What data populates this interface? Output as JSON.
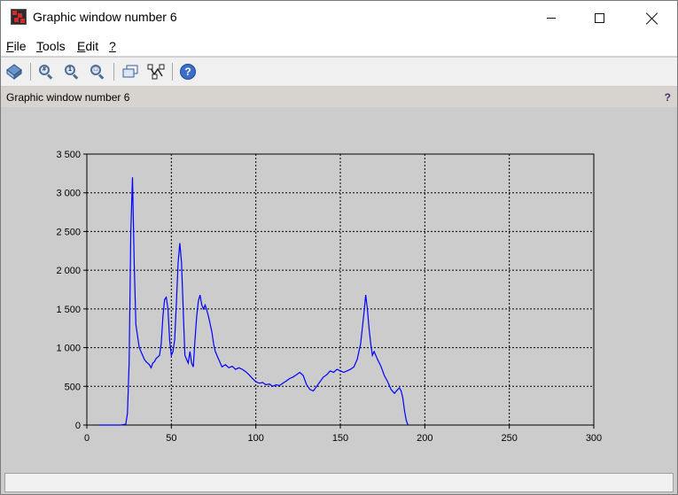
{
  "window": {
    "title": "Graphic window number 6",
    "minimize_icon": "minimize-icon",
    "maximize_icon": "maximize-icon",
    "close_icon": "close-icon"
  },
  "menu": {
    "items": [
      {
        "key": "F",
        "rest": "ile"
      },
      {
        "key": "T",
        "rest": "ools"
      },
      {
        "key": "E",
        "rest": "dit"
      },
      {
        "key": "?",
        "rest": ""
      }
    ]
  },
  "toolbar": {
    "buttons": [
      "rotate-icon",
      "zoom-grid-icon",
      "zoom-original-icon",
      "zoom-out-icon",
      "datatip-icon",
      "datatip-editor-icon",
      "help-icon"
    ]
  },
  "infobar": {
    "text": "Graphic window number 6",
    "help": "?"
  },
  "status": {
    "text": ""
  },
  "chart_data": {
    "type": "line",
    "title": "",
    "xlabel": "",
    "ylabel": "",
    "xlim": [
      0,
      300
    ],
    "ylim": [
      0,
      3500
    ],
    "x_ticks": [
      0,
      50,
      100,
      150,
      200,
      250,
      300
    ],
    "x_tick_labels": [
      "0",
      "50",
      "100",
      "150",
      "200",
      "250",
      "300"
    ],
    "y_ticks": [
      0,
      500,
      1000,
      1500,
      2000,
      2500,
      3000,
      3500
    ],
    "y_tick_labels": [
      "0",
      "500",
      "1 000",
      "1 500",
      "2 000",
      "2 500",
      "3 000",
      "3 500"
    ],
    "grid": true,
    "series": [
      {
        "color": "#0000ff",
        "x": [
          7,
          10,
          15,
          20,
          23,
          24,
          25,
          26,
          27,
          28,
          29,
          30,
          31,
          32,
          33,
          34,
          35,
          36,
          37,
          38,
          39,
          40,
          41,
          42,
          43,
          44,
          45,
          46,
          47,
          48,
          49,
          50,
          51,
          52,
          53,
          54,
          55,
          56,
          57,
          58,
          59,
          60,
          61,
          62,
          63,
          64,
          65,
          66,
          67,
          68,
          69,
          70,
          71,
          72,
          73,
          74,
          75,
          76,
          78,
          80,
          82,
          84,
          86,
          88,
          90,
          92,
          94,
          96,
          98,
          100,
          102,
          104,
          106,
          108,
          110,
          112,
          114,
          116,
          118,
          120,
          122,
          124,
          126,
          128,
          130,
          132,
          134,
          136,
          138,
          140,
          142,
          144,
          146,
          148,
          150,
          152,
          154,
          156,
          158,
          160,
          161,
          162,
          163,
          164,
          165,
          166,
          167,
          168,
          169,
          170,
          172,
          174,
          176,
          178,
          180,
          182,
          184,
          185,
          186,
          187,
          188,
          189,
          190
        ],
        "y": [
          0,
          0,
          0,
          0,
          10,
          150,
          800,
          2500,
          3200,
          2100,
          1300,
          1150,
          1000,
          950,
          900,
          850,
          820,
          800,
          780,
          740,
          800,
          820,
          860,
          880,
          900,
          1050,
          1400,
          1620,
          1650,
          1500,
          1100,
          900,
          950,
          1100,
          1600,
          2100,
          2350,
          2100,
          1500,
          900,
          850,
          800,
          950,
          800,
          750,
          1100,
          1400,
          1600,
          1680,
          1550,
          1500,
          1550,
          1480,
          1400,
          1300,
          1200,
          1050,
          950,
          850,
          750,
          780,
          740,
          760,
          720,
          740,
          720,
          690,
          650,
          600,
          560,
          540,
          550,
          520,
          530,
          500,
          520,
          510,
          540,
          570,
          600,
          620,
          650,
          680,
          640,
          520,
          460,
          440,
          500,
          560,
          620,
          650,
          700,
          680,
          720,
          700,
          680,
          700,
          720,
          750,
          850,
          950,
          1050,
          1250,
          1450,
          1680,
          1500,
          1250,
          1050,
          900,
          950,
          850,
          760,
          640,
          560,
          460,
          410,
          460,
          480,
          440,
          350,
          180,
          60,
          0
        ]
      }
    ]
  }
}
